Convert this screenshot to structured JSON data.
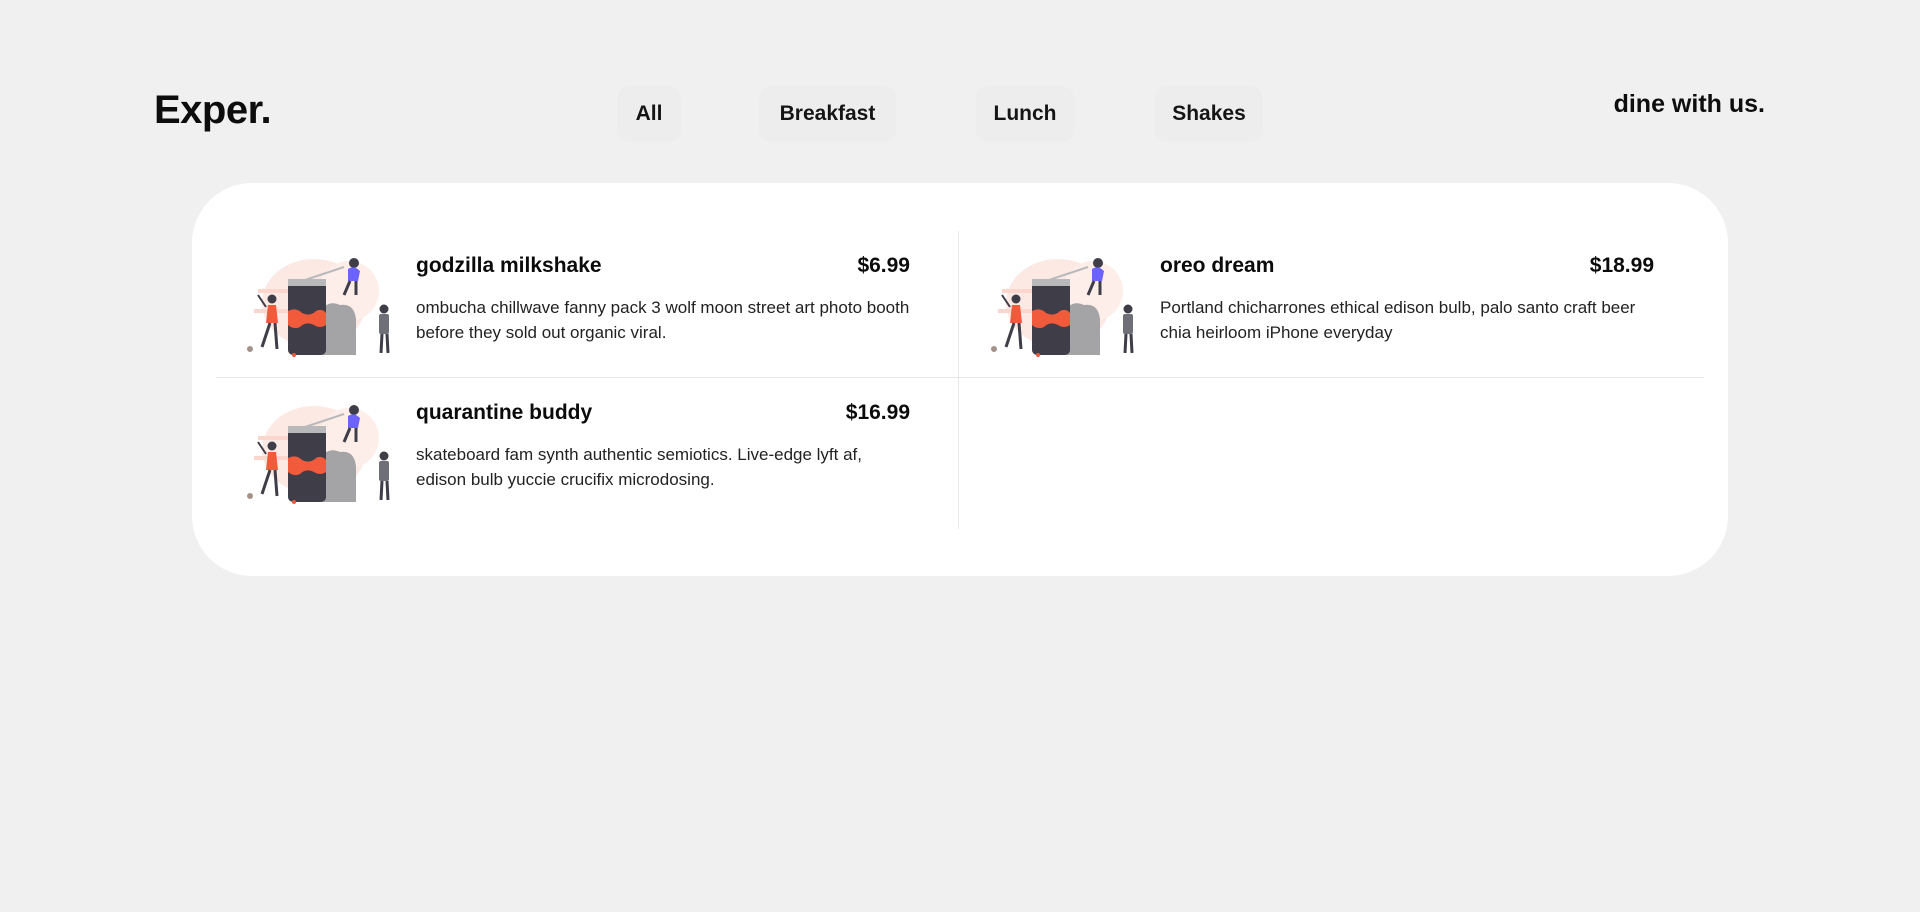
{
  "brand": {
    "logo": "Exper.",
    "tagline": "dine with us."
  },
  "nav": {
    "tabs": [
      {
        "label": "All"
      },
      {
        "label": "Breakfast"
      },
      {
        "label": "Lunch"
      },
      {
        "label": "Shakes"
      }
    ]
  },
  "menu": {
    "items": [
      {
        "title": "godzilla milkshake",
        "price": "$6.99",
        "description": "ombucha chillwave fanny pack 3 wolf moon street art photo booth before they sold out organic viral."
      },
      {
        "title": "oreo dream",
        "price": "$18.99",
        "description": "Portland chicharrones ethical edison bulb, palo santo craft beer chia heirloom iPhone everyday"
      },
      {
        "title": "quarantine buddy",
        "price": "$16.99",
        "description": "skateboard fam synth authentic semiotics. Live-edge lyft af, edison bulb yuccie crucifix microdosing."
      }
    ]
  },
  "colors": {
    "background": "#f0f0f1",
    "card": "#ffffff",
    "accent": "#f25a3c",
    "illustration_purple": "#6c63ff",
    "text": "#0b0b0b"
  },
  "icons": {
    "item_image": "milkshake-illustration-icon"
  }
}
